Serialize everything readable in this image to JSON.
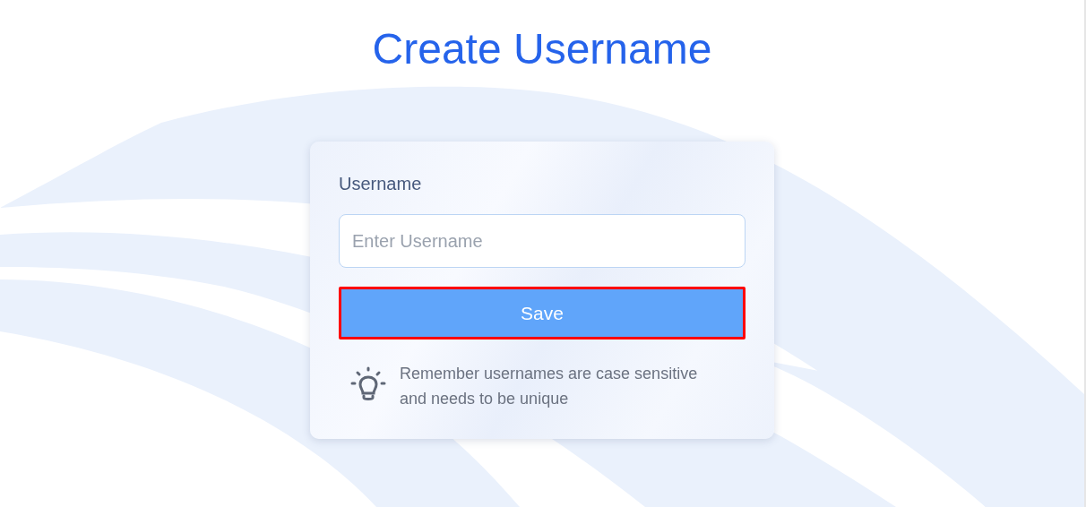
{
  "title": "Create Username",
  "form": {
    "label": "Username",
    "input": {
      "placeholder": "Enter Username"
    },
    "save_button": {
      "label": "Save",
      "highlighted": true
    },
    "tip": "Remember usernames are case sensitive and needs to be unique"
  }
}
